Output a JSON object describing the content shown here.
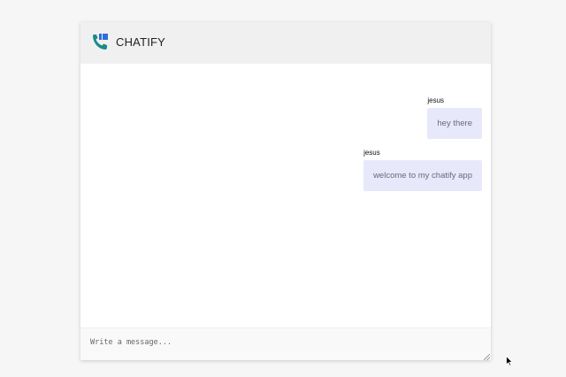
{
  "app": {
    "title": "CHATIFY",
    "logo_icon": "phone-logo-icon",
    "colors": {
      "logo_teal": "#1a8c86",
      "logo_blue": "#2c6fd6",
      "bubble_bg": "#e8e8fb",
      "header_bg": "#f0f0f0"
    }
  },
  "messages": [
    {
      "sender": "jesus",
      "text": "hey there"
    },
    {
      "sender": "jesus",
      "text": "welcome to my chatify app"
    }
  ],
  "composer": {
    "placeholder": "Write a message...",
    "value": ""
  }
}
